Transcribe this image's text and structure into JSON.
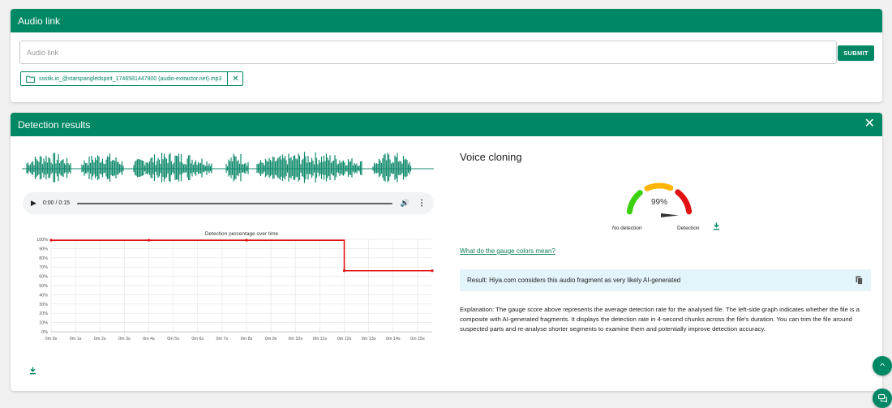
{
  "audio_link": {
    "title": "Audio link",
    "input_placeholder": "Audio link",
    "input_value": "",
    "submit_label": "SUBMIT",
    "file_chip": "ssstik.io_@starspangledspirit_1746581447800 (audio-extractor.net).mp3"
  },
  "detection": {
    "title": "Detection results",
    "player": {
      "time": "0:00 / 0:15"
    },
    "voice_title": "Voice cloning",
    "gauge": {
      "value_text": "99%",
      "value": 0.99,
      "label_left": "No detection",
      "label_right": "Detection",
      "colors": [
        "#3bd10f",
        "#ffb400",
        "#e31212"
      ]
    },
    "gauge_link": "What do the gauge colors mean?",
    "result": "Result: Hiya.com considers this audio fragment as very likely AI-generated",
    "explanation": "Explanation: The gauge score above represents the average detection rate for the analysed file. The left-side graph indicates whether the file is a composite with AI-generated fragments. It displays the detection rate in 4-second chunks across the file's duration. You can trim the file around suspected parts and re-analyse shorter segments to examine them and potentially improve detection accuracy."
  },
  "chart_data": {
    "type": "line",
    "title": "Detection percentage over time",
    "xlabel": "",
    "ylabel": "",
    "x_ticks": [
      "0m 0s",
      "0m 1s",
      "0m 2s",
      "0m 3s",
      "0m 4s",
      "0m 5s",
      "0m 6s",
      "0m 7s",
      "0m 8s",
      "0m 9s",
      "0m 10s",
      "0m 11s",
      "0m 12s",
      "0m 13s",
      "0m 14s",
      "0m 15s"
    ],
    "y_ticks": [
      "0%",
      "10%",
      "20%",
      "30%",
      "40%",
      "50%",
      "60%",
      "70%",
      "80%",
      "90%",
      "100%"
    ],
    "ylim": [
      0,
      100
    ],
    "xlim": [
      0,
      15.6
    ],
    "series": [
      {
        "color": "#e31212",
        "step": true,
        "points": [
          [
            0,
            99
          ],
          [
            4,
            99
          ],
          [
            8,
            99
          ],
          [
            12,
            66
          ],
          [
            15.6,
            66
          ]
        ]
      }
    ],
    "grid": true
  },
  "colors": {
    "accent": "#008763",
    "line": "#e31212",
    "wave": "#108a6c"
  }
}
